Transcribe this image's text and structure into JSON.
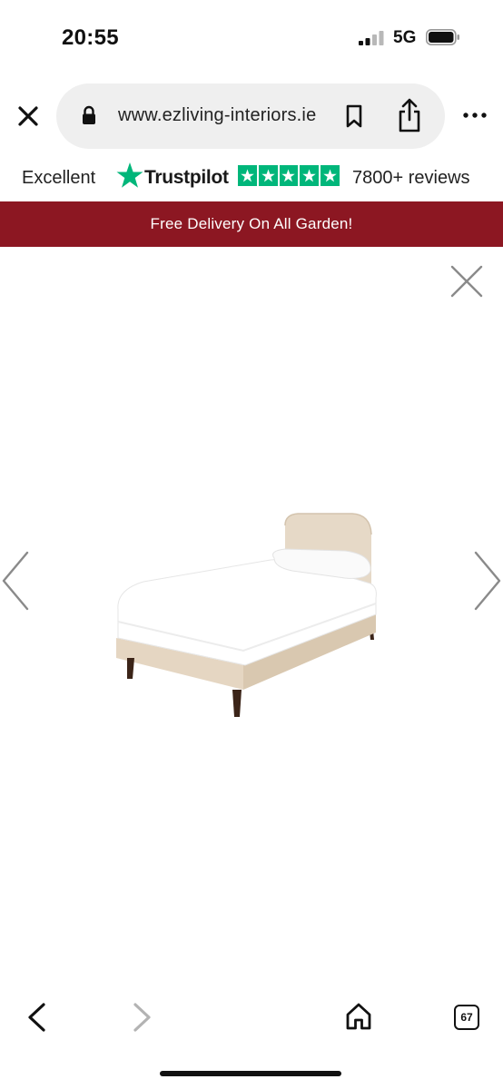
{
  "status_bar": {
    "time": "20:55",
    "network": "5G",
    "icons": [
      "signal-icon",
      "battery-icon"
    ]
  },
  "browser": {
    "url": "www.ezliving-interiors.ie",
    "icons": [
      "close-icon",
      "lock-icon",
      "bookmark-icon",
      "share-icon",
      "more-icon"
    ]
  },
  "trustpilot": {
    "rating_label": "Excellent",
    "brand": "Trustpilot",
    "stars": 5,
    "reviews": "7800+ reviews",
    "color": "#00b67a"
  },
  "promo": {
    "text": "Free Delivery On All Garden!",
    "background": "#8c1722"
  },
  "gallery": {
    "image": "single-upholstered-bed",
    "icons": [
      "close-icon",
      "chevron-left-icon",
      "chevron-right-icon"
    ]
  },
  "toolbar": {
    "tabs_count": "67",
    "icons": [
      "back-icon",
      "forward-icon",
      "home-icon",
      "tabs-icon"
    ]
  }
}
